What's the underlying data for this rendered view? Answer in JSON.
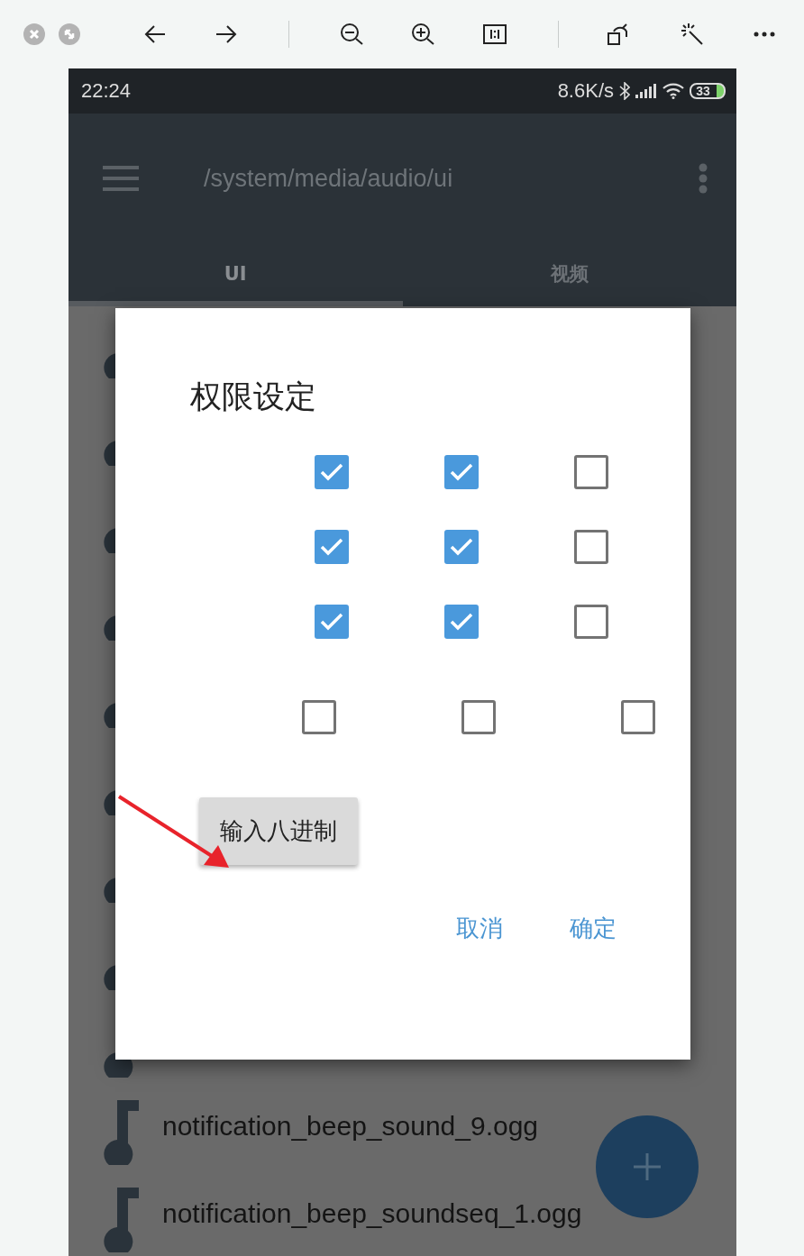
{
  "status_bar": {
    "time": "22:24",
    "speed": "8.6K/s",
    "battery": "33"
  },
  "app_bar": {
    "path": "/system/media/audio/ui"
  },
  "tabs": [
    {
      "label": "UI",
      "selected": true
    },
    {
      "label": "视频",
      "selected": false
    }
  ],
  "files": [
    {
      "name": "notification_beep_sound_9.ogg"
    },
    {
      "name": "notification_beep_soundseq_1.ogg"
    }
  ],
  "dialog": {
    "title": "权限设定",
    "rows": [
      {
        "kind": "grid",
        "checks": [
          {
            "checked": true
          },
          {
            "checked": true
          },
          {
            "checked": false
          }
        ]
      },
      {
        "kind": "grid",
        "checks": [
          {
            "checked": true
          },
          {
            "checked": true
          },
          {
            "checked": false
          }
        ]
      },
      {
        "kind": "grid",
        "checks": [
          {
            "checked": true
          },
          {
            "checked": true
          },
          {
            "checked": false
          }
        ]
      },
      {
        "kind": "wide",
        "checks": [
          {
            "checked": false
          },
          {
            "checked": false
          },
          {
            "checked": false
          }
        ]
      }
    ],
    "octal_button": "输入八进制",
    "actions": [
      {
        "label": "取消"
      },
      {
        "label": "确定"
      }
    ]
  }
}
